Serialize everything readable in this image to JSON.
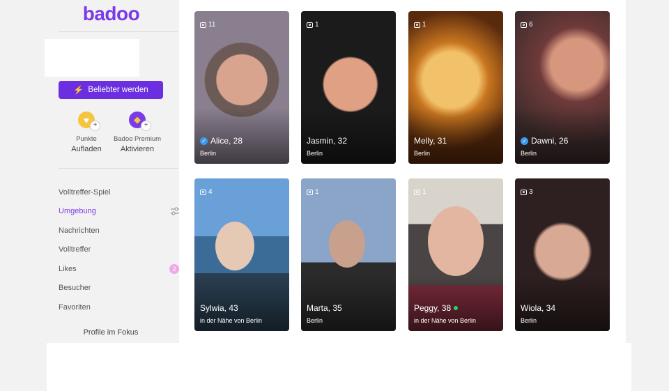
{
  "sidebar": {
    "logo": "badoo",
    "boost_label": "Beliebter werden",
    "perks": [
      {
        "small": "Punkte",
        "big": "Aufladen",
        "icon": "heart-coin-icon",
        "color": "#f5c542"
      },
      {
        "small": "Badoo Premium",
        "big": "Aktivieren",
        "icon": "diamond-icon",
        "color": "#7a3be8"
      }
    ],
    "nav": [
      {
        "label": "Volltreffer-Spiel"
      },
      {
        "label": "Umgebung",
        "active": true
      },
      {
        "label": "Nachrichten"
      },
      {
        "label": "Volltreffer"
      },
      {
        "label": "Likes",
        "badge": "2"
      },
      {
        "label": "Besucher"
      },
      {
        "label": "Favoriten"
      }
    ],
    "focus_title": "Profile im Fokus"
  },
  "profiles": [
    {
      "name": "Alice, 28",
      "city": "Berlin",
      "photos": "11",
      "verified": true,
      "online": false
    },
    {
      "name": "Jasmin, 32",
      "city": "Berlin",
      "photos": "1",
      "verified": false,
      "online": false
    },
    {
      "name": "Melly, 31",
      "city": "Berlin",
      "photos": "1",
      "verified": false,
      "online": false
    },
    {
      "name": "Dawni, 26",
      "city": "Berlin",
      "photos": "6",
      "verified": true,
      "online": false
    },
    {
      "name": "Sylwia, 43",
      "city": "in der Nähe von Berlin",
      "photos": "4",
      "verified": false,
      "online": false
    },
    {
      "name": "Marta, 35",
      "city": "Berlin",
      "photos": "1",
      "verified": false,
      "online": false
    },
    {
      "name": "Peggy, 38",
      "city": "in der Nähe von Berlin",
      "photos": "1",
      "verified": false,
      "online": true
    },
    {
      "name": "Wiola, 34",
      "city": "Berlin",
      "photos": "3",
      "verified": false,
      "online": false
    }
  ],
  "colors": {
    "brand": "#7a3be8",
    "button": "#6b2fe0",
    "badge": "#f0a8e8",
    "verified": "#3d9bea",
    "online": "#2ecc71"
  }
}
